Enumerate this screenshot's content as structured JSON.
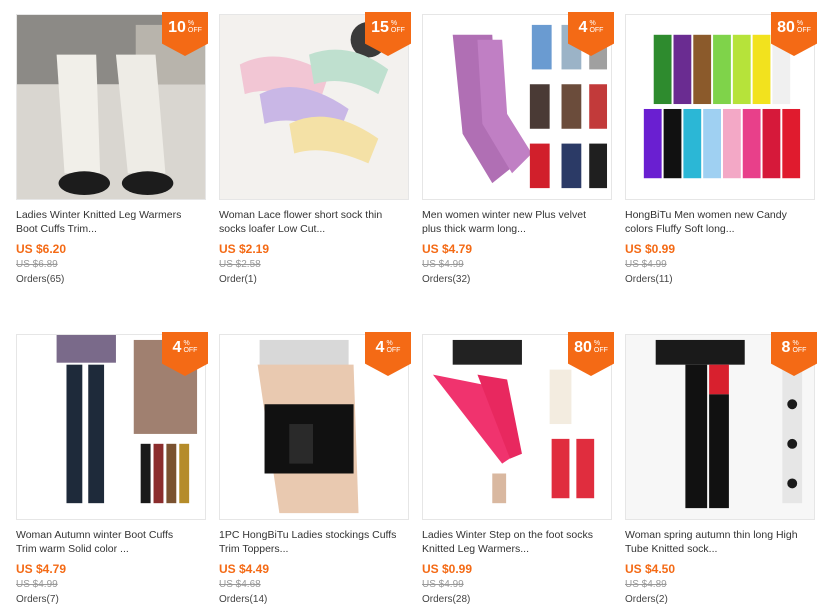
{
  "products": [
    {
      "discount": "10",
      "title1": "Ladies Winter Knitted Leg Warmers",
      "title2": "Boot Cuffs Trim...",
      "price": "US $6.20",
      "old_price": "US $6.89",
      "orders": "Orders(65)"
    },
    {
      "discount": "15",
      "title1": "Woman Lace flower short sock thin",
      "title2": "socks loafer Low Cut...",
      "price": "US $2.19",
      "old_price": "US $2.58",
      "orders": "Order(1)"
    },
    {
      "discount": "4",
      "title1": "Men women winter new Plus velvet",
      "title2": "plus thick warm long...",
      "price": "US $4.79",
      "old_price": "US $4.99",
      "orders": "Orders(32)"
    },
    {
      "discount": "80",
      "title1": "HongBiTu Men women new Candy",
      "title2": "colors Fluffy Soft long...",
      "price": "US $0.99",
      "old_price": "US $4.99",
      "orders": "Orders(11)"
    },
    {
      "discount": "4",
      "title1": "Woman Autumn winter Boot Cuffs",
      "title2": "Trim warm Solid color ...",
      "price": "US $4.79",
      "old_price": "US $4.99",
      "orders": "Orders(7)"
    },
    {
      "discount": "4",
      "title1": "1PC HongBiTu Ladies stockings Cuffs",
      "title2": "Trim Toppers...",
      "price": "US $4.49",
      "old_price": "US $4.68",
      "orders": "Orders(14)"
    },
    {
      "discount": "80",
      "title1": "Ladies Winter Step on the foot socks",
      "title2": "Knitted Leg Warmers...",
      "price": "US $0.99",
      "old_price": "US $4.99",
      "orders": "Orders(28)"
    },
    {
      "discount": "8",
      "title1": "Woman spring autumn thin long High",
      "title2": "Tube Knitted sock...",
      "price": "US $4.50",
      "old_price": "US $4.89",
      "orders": "Orders(2)"
    }
  ],
  "badge_pct": "%",
  "badge_off": "OFF",
  "colors": {
    "accent": "#f46a15",
    "old_price": "#999999"
  }
}
